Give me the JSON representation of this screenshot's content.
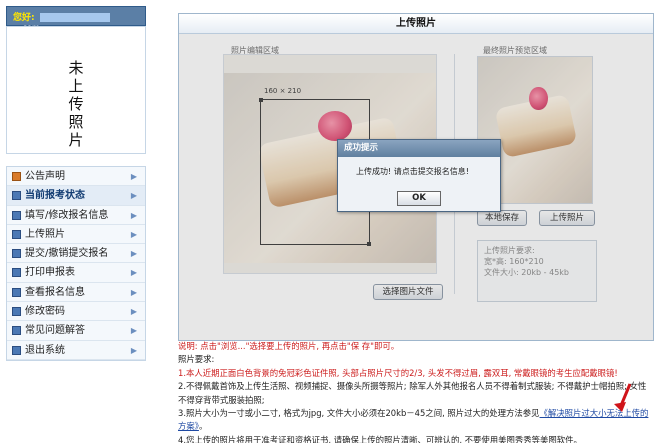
{
  "greeting": {
    "label": "您好:",
    "suffix": "...com"
  },
  "photo_placeholder": "未上传照片",
  "menu": [
    {
      "label": "公告声明",
      "icon": "home-icon",
      "active": false
    },
    {
      "label": "当前报考状态",
      "icon": "list-icon",
      "active": true
    },
    {
      "label": "填写/修改报名信息",
      "icon": "list-icon",
      "active": false
    },
    {
      "label": "上传照片",
      "icon": "list-icon",
      "active": false
    },
    {
      "label": "提交/撤销提交报名",
      "icon": "list-icon",
      "active": false
    },
    {
      "label": "打印申报表",
      "icon": "list-icon",
      "active": false
    },
    {
      "label": "查看报名信息",
      "icon": "list-icon",
      "active": false
    },
    {
      "label": "修改密码",
      "icon": "list-icon",
      "active": false
    },
    {
      "label": "常见问题解答",
      "icon": "list-icon",
      "active": false
    },
    {
      "label": "退出系统",
      "icon": "list-icon",
      "active": false
    }
  ],
  "panel": {
    "title": "上传照片",
    "edit_area_label": "照片编辑区域",
    "preview_area_label": "最终照片预览区域",
    "crop_size": "160 × 210",
    "save_button": "本地保存",
    "upload_button": "上传照片",
    "choose_button": "选择图片文件",
    "photo_req_title": "上传照片要求:",
    "photo_req_size": "宽*高: 160*210",
    "photo_req_file": "文件大小: 20kb - 45kb"
  },
  "dialog": {
    "title": "成功提示",
    "message": "上传成功! 请点击提交报名信息!",
    "ok": "OK"
  },
  "notes": {
    "instruction": "说明: 点击\"浏览...\"选择要上传的照片, 再点击\"保 存\"即可。",
    "req_title": "照片要求:",
    "item1": "1.本人近期正面白色背景的免冠彩色证件照, 头部占照片尺寸的2/3, 头发不得过眉, 露双耳, 常戴眼镜的考生应配戴眼镜!",
    "item2": "2.不得佩戴首饰及上传生活照、视频捕捉、摄像头所摄等照片; 除军人外其他报名人员不得着制式服装; 不得戴护士帽拍照; 女性不得穿背带式服装拍照;",
    "item3_pre": "3.照片大小为一寸或小二寸, 格式为jpg, 文件大小必须在20kb－45之间, 照片过大的处理方法参见",
    "item3_link": "《解决照片过大小无法上传的方案》",
    "item3_post": "。",
    "item4": "4.您上传的照片将用于准考证和资格证书, 请确保上传的照片清晰、可辨认的, 不要使用美图秀秀等美图软件。"
  }
}
